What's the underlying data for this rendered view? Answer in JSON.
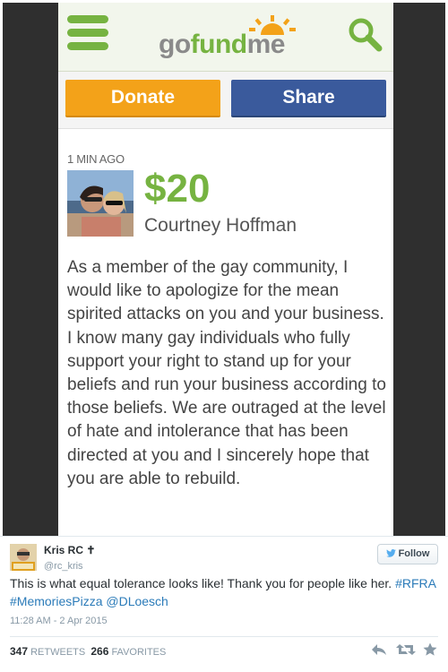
{
  "gofundme": {
    "logo": {
      "go": "go",
      "fund": "fund",
      "me": "me"
    },
    "donate_label": "Donate",
    "share_label": "Share",
    "donation": {
      "time_ago": "1 MIN AGO",
      "amount": "$20",
      "donor": "Courtney Hoffman",
      "message": "As a member of the gay community, I would like to apologize for the mean spirited attacks on you and your business. I know many gay individuals who fully support your right to stand up for your beliefs and run your business according to those beliefs. We are outraged at the level of hate and intolerance that has been directed at you and I sincerely hope that you are able to rebuild."
    }
  },
  "tweet": {
    "name": "Kris RC ✝",
    "handle": "@rc_kris",
    "follow_label": "Follow",
    "text_plain": "This is what equal tolerance looks like! Thank you for people like her. ",
    "hashtags": [
      "#RFRA",
      "#MemoriesPizza"
    ],
    "mention": "@DLoesch",
    "timestamp": "11:28 AM - 2 Apr 2015",
    "retweets_count": "347",
    "retweets_label": "RETWEETS",
    "favorites_count": "266",
    "favorites_label": "FAVORITES"
  },
  "colors": {
    "gfm_green": "#76b341",
    "donate_orange": "#f3a219",
    "share_blue": "#3a5a9c",
    "twitter_link": "#2b7bb9"
  },
  "icons": [
    "menu-icon",
    "search-icon",
    "twitter-bird-icon",
    "reply-icon",
    "retweet-icon",
    "favorite-icon"
  ]
}
